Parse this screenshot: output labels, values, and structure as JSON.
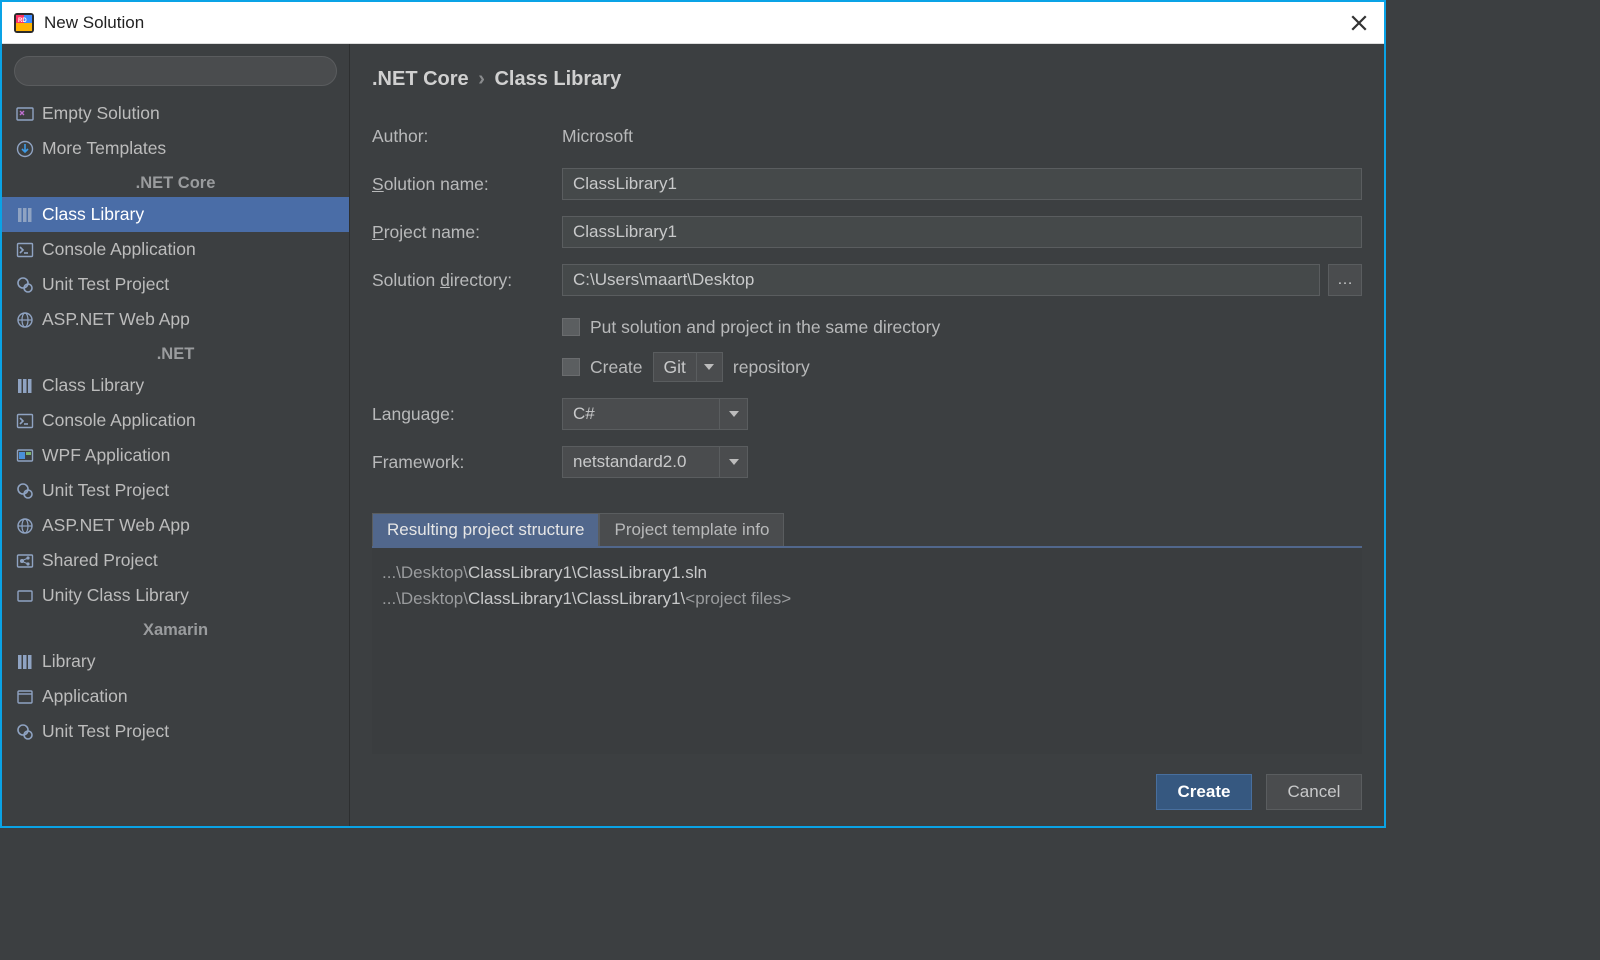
{
  "window": {
    "title": "New Solution"
  },
  "sidebar": {
    "top": [
      {
        "label": "Empty Solution",
        "icon": "empty-solution-icon"
      },
      {
        "label": "More Templates",
        "icon": "download-icon"
      }
    ],
    "groups": [
      {
        "header": ".NET Core",
        "items": [
          {
            "label": "Class Library",
            "icon": "library-icon",
            "selected": true
          },
          {
            "label": "Console Application",
            "icon": "console-icon"
          },
          {
            "label": "Unit Test Project",
            "icon": "test-icon"
          },
          {
            "label": "ASP.NET Web App",
            "icon": "globe-icon"
          }
        ]
      },
      {
        "header": ".NET",
        "items": [
          {
            "label": "Class Library",
            "icon": "library-icon"
          },
          {
            "label": "Console Application",
            "icon": "console-icon"
          },
          {
            "label": "WPF Application",
            "icon": "wpf-icon"
          },
          {
            "label": "Unit Test Project",
            "icon": "test-icon"
          },
          {
            "label": "ASP.NET Web App",
            "icon": "globe-icon"
          },
          {
            "label": "Shared Project",
            "icon": "shared-icon"
          },
          {
            "label": "Unity Class Library",
            "icon": "unity-icon"
          }
        ]
      },
      {
        "header": "Xamarin",
        "items": [
          {
            "label": "Library",
            "icon": "library-icon"
          },
          {
            "label": "Application",
            "icon": "app-icon"
          },
          {
            "label": "Unit Test Project",
            "icon": "test-icon"
          }
        ]
      }
    ]
  },
  "breadcrumb": {
    "root": ".NET Core",
    "leaf": "Class Library"
  },
  "form": {
    "author_label": "Author:",
    "author_value": "Microsoft",
    "solution_name_label": "Solution name:",
    "solution_name_value": "ClassLibrary1",
    "project_name_label": "Project name:",
    "project_name_value": "ClassLibrary1",
    "solution_dir_label": "Solution directory:",
    "solution_dir_value": "C:\\Users\\maart\\Desktop",
    "same_dir_label": "Put solution and project in the same directory",
    "create_label": "Create",
    "vcs_value": "Git",
    "repository_label": "repository",
    "language_label": "Language:",
    "language_value": "C#",
    "framework_label": "Framework:",
    "framework_value": "netstandard2.0"
  },
  "tabs": {
    "t1": "Resulting project structure",
    "t2": "Project template info"
  },
  "structure": {
    "l1_prefix": "...\\Desktop\\",
    "l1_hl": "ClassLibrary1\\ClassLibrary1.sln",
    "l2_prefix": "...\\Desktop\\",
    "l2_hl": "ClassLibrary1\\ClassLibrary1\\",
    "l2_suffix": "<project files>"
  },
  "buttons": {
    "create": "Create",
    "cancel": "Cancel"
  }
}
